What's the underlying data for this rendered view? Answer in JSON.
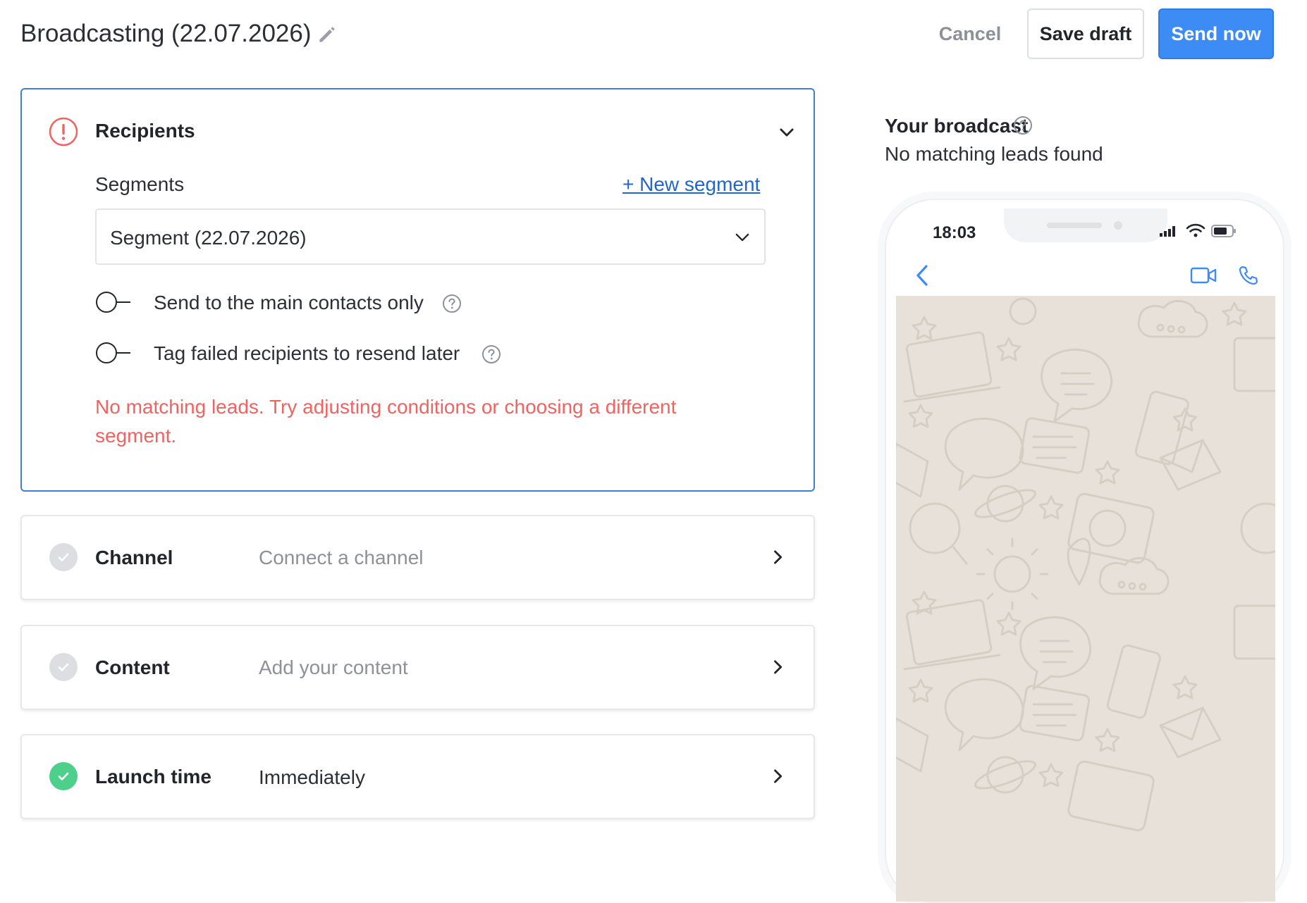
{
  "header": {
    "title": "Broadcasting (22.07.2026)",
    "cancel_label": "Cancel",
    "save_draft_label": "Save draft",
    "send_now_label": "Send now"
  },
  "recipients": {
    "title": "Recipients",
    "segments_label": "Segments",
    "new_segment_label": "+ New segment",
    "selected_segment": "Segment (22.07.2026)",
    "option_main_contacts": "Send to the main contacts only",
    "option_tag_failed": "Tag failed recipients to resend later",
    "error_message": "No matching leads. Try adjusting conditions or choosing a different segment.",
    "status": "error"
  },
  "channel": {
    "title": "Channel",
    "value": "Connect a channel",
    "status": "incomplete"
  },
  "content": {
    "title": "Content",
    "value": "Add your content",
    "status": "incomplete"
  },
  "launch": {
    "title": "Launch time",
    "value": "Immediately",
    "status": "complete"
  },
  "preview": {
    "title": "Your broadcast",
    "subtitle": "No matching leads found",
    "phone_time": "18:03"
  },
  "colors": {
    "primary": "#3d8cf5",
    "error": "#ef6461",
    "success": "#4cd08a",
    "link": "#2266c8",
    "chat_background": "#e7e1d9"
  },
  "icons": {
    "edit": "pencil-icon",
    "alert": "alert-circle-icon",
    "help": "question-circle-icon",
    "check": "check-icon",
    "chevron_down": "chevron-down-icon",
    "chevron_right": "chevron-right-icon"
  }
}
